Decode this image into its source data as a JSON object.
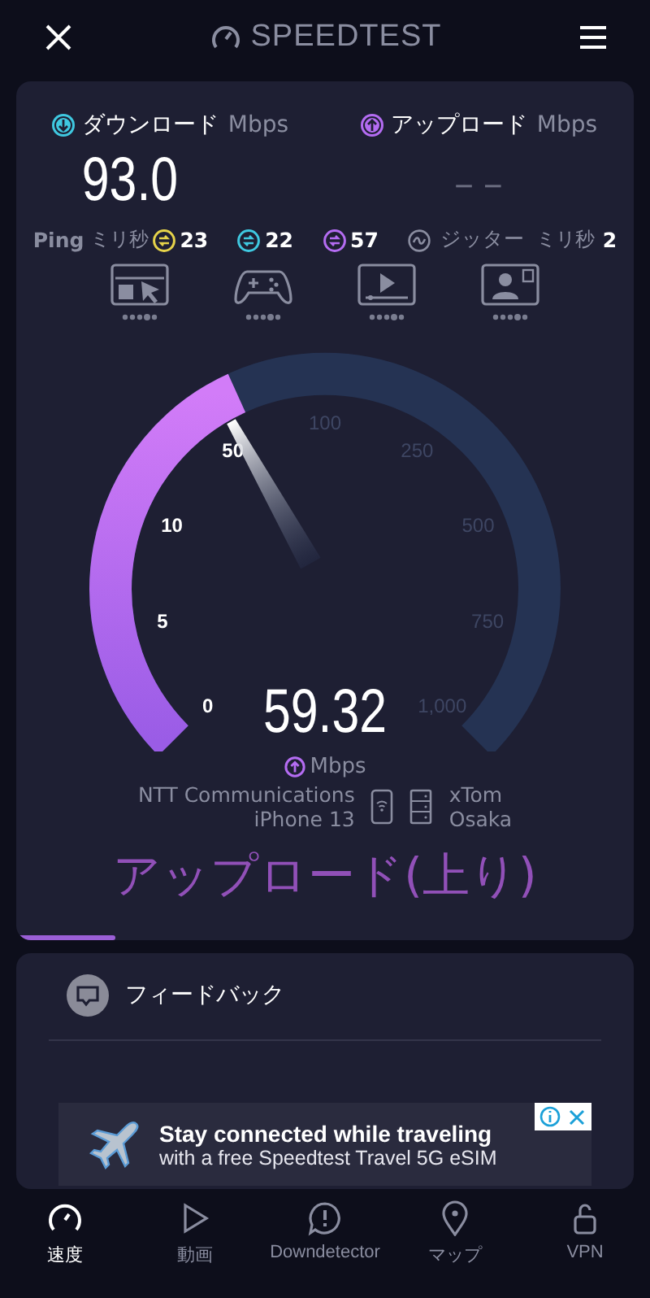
{
  "header": {
    "logo": "SPEEDTEST"
  },
  "results": [
    {
      "kind": "download",
      "label": "ダウンロード",
      "unit": "Mbps",
      "value": "93.0"
    },
    {
      "kind": "upload",
      "label": "アップロード",
      "unit": "Mbps",
      "value": "– –"
    }
  ],
  "ping": {
    "label": "Ping",
    "unit": "ミリ秒",
    "values": [
      {
        "kind": "idle",
        "value": "23"
      },
      {
        "kind": "download",
        "value": "22"
      },
      {
        "kind": "upload",
        "value": "57"
      }
    ]
  },
  "jitter": {
    "label": "ジッター",
    "unit": "ミリ秒",
    "value": "2"
  },
  "activities": [
    {
      "kind": "browsing"
    },
    {
      "kind": "gaming"
    },
    {
      "kind": "video"
    },
    {
      "kind": "video_call"
    }
  ],
  "gauge": {
    "ticks": [
      "0",
      "5",
      "10",
      "50",
      "100",
      "250",
      "500",
      "750",
      "1,000"
    ],
    "reading": "59.32",
    "unit": "Mbps"
  },
  "connection": {
    "provider": "NTT Communications",
    "device": "iPhone 13",
    "server": "xTom",
    "location": "Osaka"
  },
  "phase": {
    "label": "アップロード(上り)"
  },
  "feedback": {
    "label": "フィードバック"
  },
  "ad": {
    "title": "Stay connected while traveling",
    "subtitle": "with a free Speedtest Travel 5G eSIM"
  },
  "nav": [
    {
      "kind": "speed",
      "label": "速度",
      "selected": true
    },
    {
      "kind": "video",
      "label": "動画",
      "selected": false
    },
    {
      "kind": "downdetector",
      "label": "Downdetector",
      "selected": false
    },
    {
      "kind": "map",
      "label": "マップ",
      "selected": false
    },
    {
      "kind": "vpn",
      "label": "VPN",
      "selected": false
    }
  ]
}
